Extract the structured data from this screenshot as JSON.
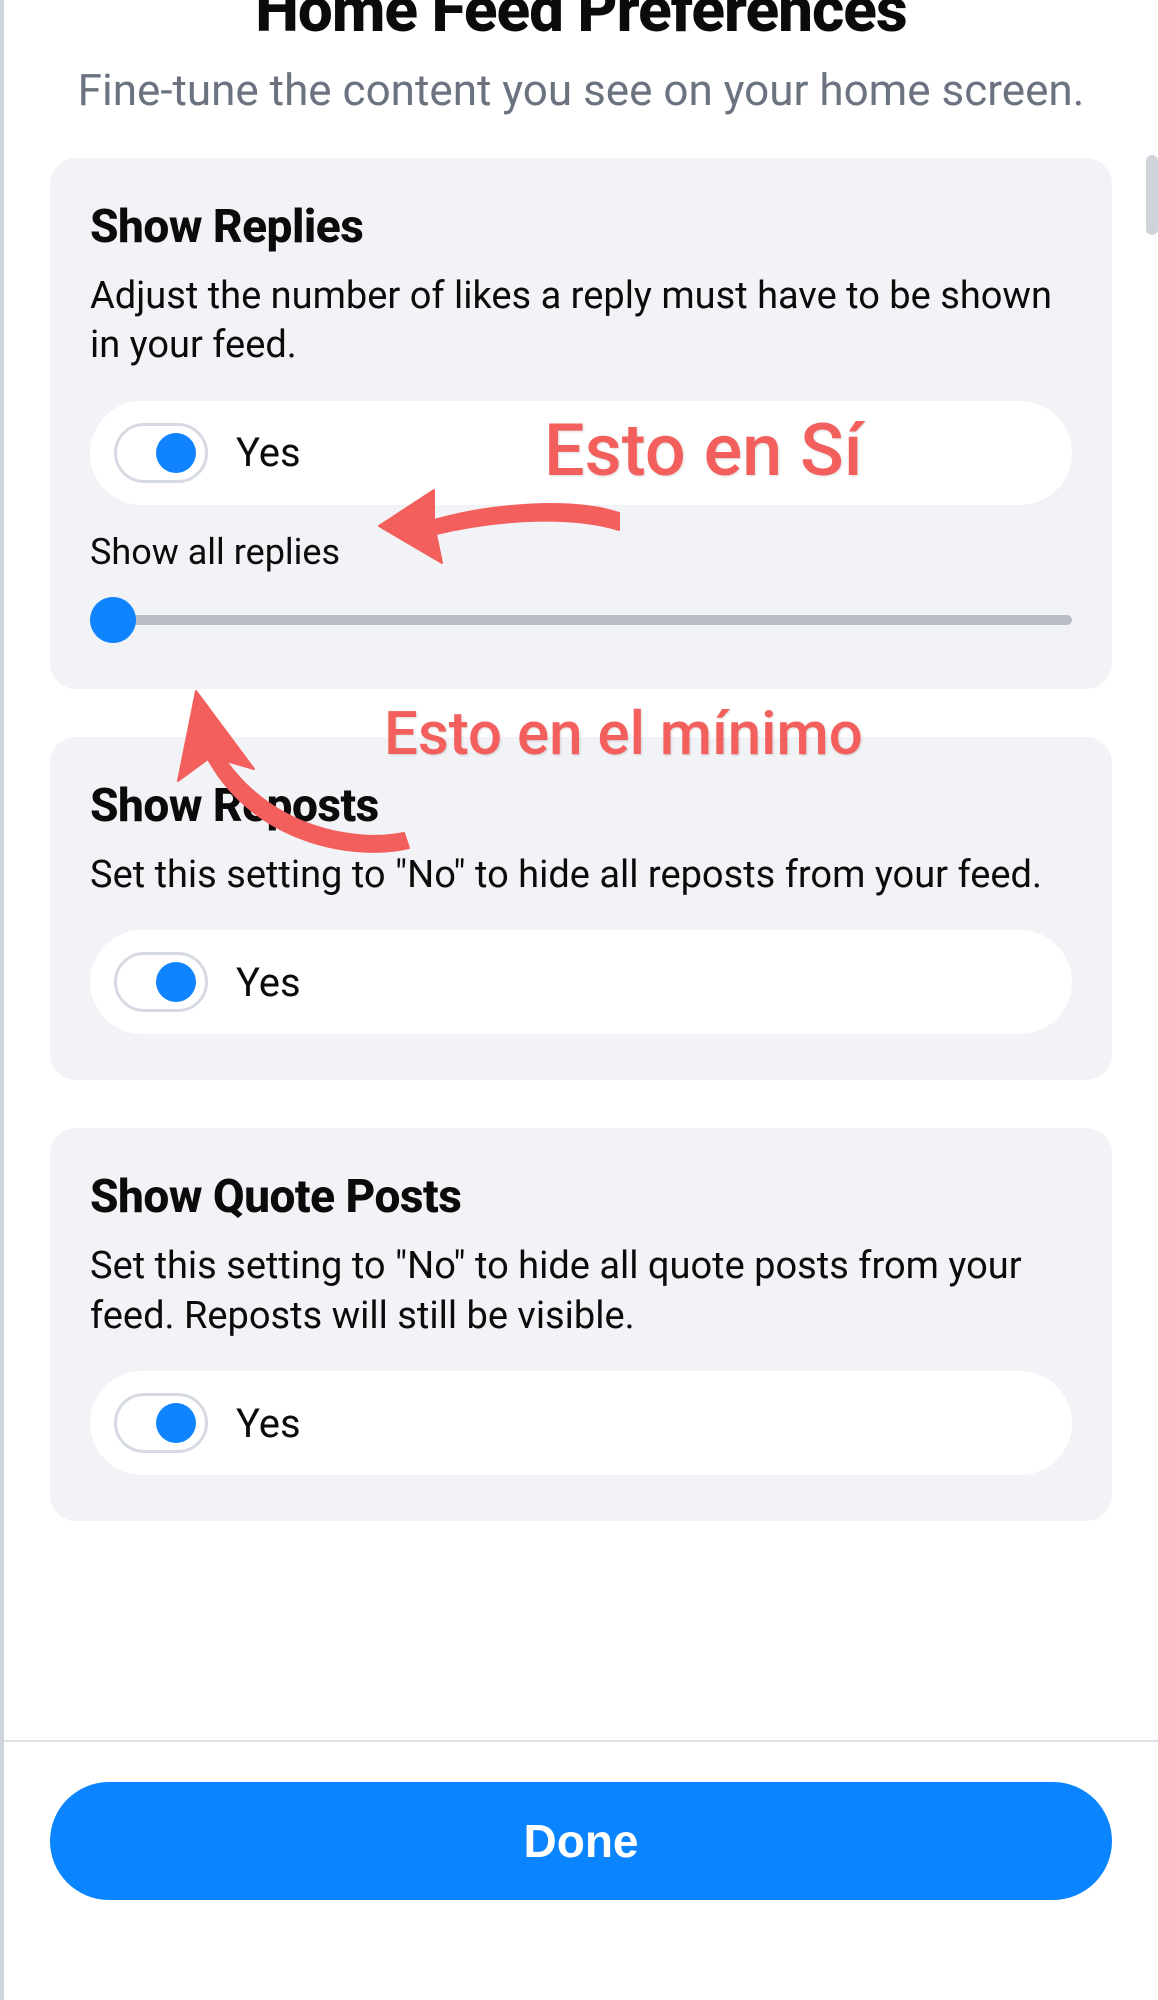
{
  "header": {
    "title": "Home Feed Preferences",
    "subtitle": "Fine-tune the content you see on your home screen."
  },
  "sections": {
    "showReplies": {
      "title": "Show Replies",
      "description": "Adjust the number of likes a reply must have to be shown in your feed.",
      "toggleLabel": "Yes",
      "toggleOn": true,
      "sliderLabel": "Show all replies",
      "sliderValue": 0
    },
    "showReposts": {
      "title": "Show Reposts",
      "description": "Set this setting to \"No\" to hide all reposts from your feed.",
      "toggleLabel": "Yes",
      "toggleOn": true
    },
    "showQuotePosts": {
      "title": "Show Quote Posts",
      "description": "Set this setting to \"No\" to hide all quote posts from your feed. Reposts will still be visible.",
      "toggleLabel": "Yes",
      "toggleOn": true
    }
  },
  "footer": {
    "doneLabel": "Done"
  },
  "annotations": {
    "topText": "Esto en Sí",
    "bottomText": "Esto en el mínimo"
  },
  "colors": {
    "accent": "#1083fe",
    "annotation": "#f25f5c",
    "cardBg": "#f2f3f6",
    "muted": "#6b7380"
  }
}
